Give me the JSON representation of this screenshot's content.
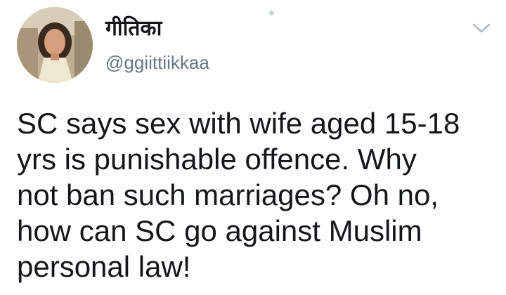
{
  "author": {
    "display_name": "गीतिका",
    "handle": "@ggiittiikkaa",
    "avatar_icon": "user-avatar-photo"
  },
  "menu": {
    "icon": "chevron-down-icon"
  },
  "tweet": {
    "text_lines": [
      "SC says sex with wife aged 15-18",
      "yrs is punishable offence. Why",
      "not ban such marriages? Oh no,",
      "how can SC go against Muslim",
      "personal law!"
    ]
  },
  "colors": {
    "text": "#14171a",
    "handle": "#657786",
    "background": "#ffffff"
  }
}
